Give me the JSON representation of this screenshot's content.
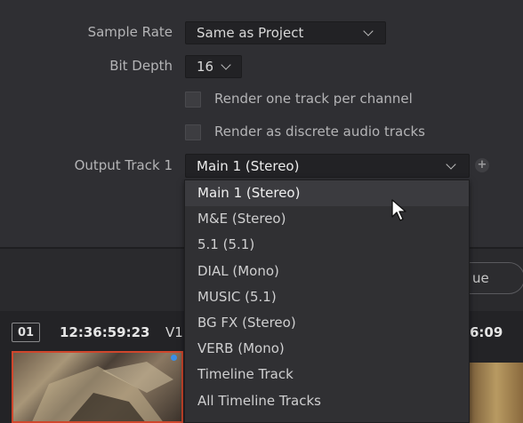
{
  "settings": {
    "sample_rate": {
      "label": "Sample Rate",
      "value": "Same as Project"
    },
    "bit_depth": {
      "label": "Bit Depth",
      "value": "16"
    },
    "render_per_channel": {
      "label": "Render one track per channel",
      "checked": false
    },
    "render_discrete": {
      "label": "Render as discrete audio tracks",
      "checked": false
    },
    "output_track": {
      "label": "Output Track 1",
      "value": "Main 1 (Stereo)",
      "add_icon": "plus-circle-icon"
    }
  },
  "dropdown": {
    "items": [
      {
        "label": "Main 1 (Stereo)",
        "selected": true
      },
      {
        "label": "M&E (Stereo)"
      },
      {
        "label": "5.1 (5.1)"
      },
      {
        "label": "DIAL (Mono)"
      },
      {
        "label": "MUSIC (5.1)"
      },
      {
        "label": "BG FX (Stereo)"
      },
      {
        "label": "VERB (Mono)"
      },
      {
        "label": "Timeline Track"
      },
      {
        "label": "All Timeline Tracks"
      }
    ]
  },
  "partial_button": {
    "label": "ue"
  },
  "clip_strip": {
    "clip_number": "01",
    "timecode": "12:36:59:23",
    "track": "V1",
    "timecode_right": "6:09"
  },
  "colors": {
    "clip_border": "#d0462c",
    "clip_dot": "#3a8ee8",
    "panel_bg": "#2f2f33"
  }
}
